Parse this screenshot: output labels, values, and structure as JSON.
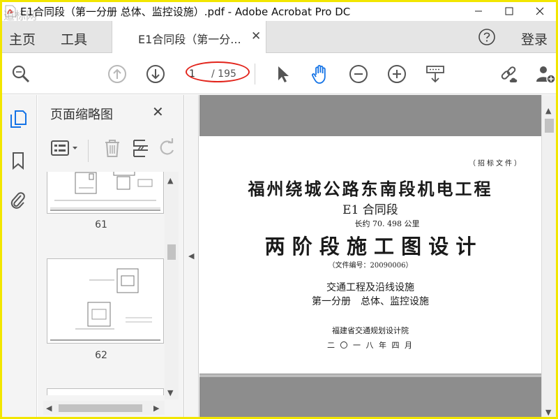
{
  "window": {
    "title": "E1合同段（第一分册 总体、监控设施）.pdf - Adobe Acrobat Pro DC",
    "watermark": "道标网"
  },
  "menu": {
    "home": "主页",
    "tools": "工具",
    "tab_label": "E1合同段（第一分...",
    "login": "登录"
  },
  "toolbar": {
    "page_current": "1",
    "page_total": "/ 195"
  },
  "thumbnails": {
    "title": "页面缩略图",
    "pages": [
      "61",
      "62"
    ]
  },
  "document": {
    "corner_tag": "（招标文件）",
    "title": "福州绕城公路东南段机电工程",
    "section": "E1 合同段",
    "length": "长约 70. 498 公里",
    "phase": "两 阶 段 施 工 图 设 计",
    "file_no": "（文件编号：20090006）",
    "volume": "交通工程及沿线设施",
    "part": "第一分册　总体、监控设施",
    "institute": "福建省交通规划设计院",
    "date": "二 〇 一 八 年 四 月"
  },
  "colors": {
    "highlight_ellipse": "#e2231a",
    "accent_blue": "#1473e6",
    "frame_border": "#f2e600"
  }
}
